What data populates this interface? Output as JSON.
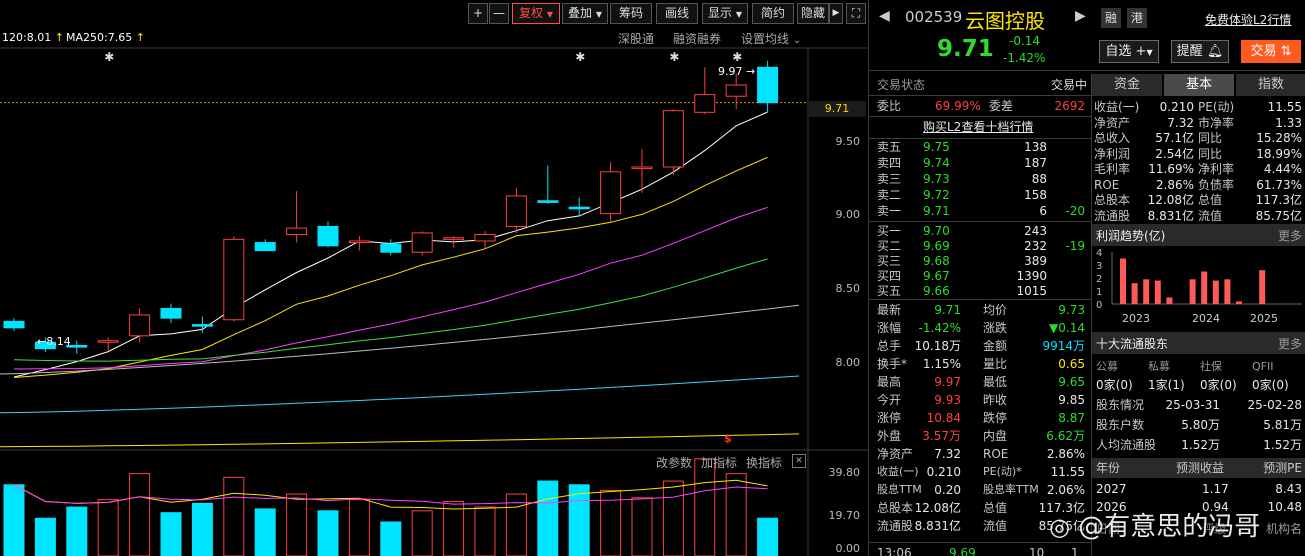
{
  "toolbar": {
    "plus": "+",
    "minus": "—",
    "fq": "复权",
    "overlay": "叠加",
    "chips": "筹码",
    "draw": "画线",
    "display": "显示",
    "simple": "简约",
    "hide": "隐藏",
    "arrow": "▶",
    "expand": "⛶"
  },
  "indicators": {
    "ma120": "120:8.01",
    "ma250": "MA250:7.65",
    "sgt": "深股通",
    "margin": "融资融券",
    "set_ma": "设置均线"
  },
  "chart_labels": {
    "high_mark": "9.97",
    "low_mark": "8.14",
    "last_price": "9.71",
    "s_mark": "$",
    "main_ticks": [
      "9.50",
      "9.00",
      "8.50",
      "8.00"
    ],
    "vol_ticks": [
      "39.80",
      "19.70",
      "0.00"
    ],
    "vol_tools": [
      "改参数",
      "加指标",
      "换指标"
    ],
    "close_glyph": "✕"
  },
  "chart_data": {
    "type": "candlestick",
    "ohlc": [
      [
        8.35,
        8.37,
        8.29,
        8.31
      ],
      [
        8.22,
        8.25,
        8.16,
        8.18
      ],
      [
        8.2,
        8.23,
        8.15,
        8.19
      ],
      [
        8.22,
        8.25,
        8.17,
        8.23
      ],
      [
        8.26,
        8.43,
        8.22,
        8.39
      ],
      [
        8.43,
        8.46,
        8.34,
        8.37
      ],
      [
        8.33,
        8.38,
        8.28,
        8.32
      ],
      [
        8.36,
        8.88,
        8.35,
        8.86
      ],
      [
        8.84,
        8.86,
        8.79,
        8.79
      ],
      [
        8.89,
        9.16,
        8.84,
        8.93
      ],
      [
        8.94,
        8.97,
        8.81,
        8.82
      ],
      [
        8.84,
        8.88,
        8.79,
        8.85
      ],
      [
        8.83,
        8.86,
        8.76,
        8.78
      ],
      [
        8.78,
        8.91,
        8.76,
        8.9
      ],
      [
        8.86,
        8.88,
        8.81,
        8.87
      ],
      [
        8.85,
        8.91,
        8.8,
        8.89
      ],
      [
        8.94,
        9.18,
        8.9,
        9.13
      ],
      [
        9.1,
        9.32,
        9.08,
        9.09
      ],
      [
        9.06,
        9.12,
        9.0,
        9.05
      ],
      [
        9.02,
        9.34,
        8.97,
        9.28
      ],
      [
        9.3,
        9.42,
        9.15,
        9.31
      ],
      [
        9.31,
        9.67,
        9.26,
        9.66
      ],
      [
        9.65,
        9.93,
        9.64,
        9.76
      ],
      [
        9.75,
        9.89,
        9.67,
        9.82
      ],
      [
        9.93,
        9.97,
        9.65,
        9.71
      ]
    ],
    "volume": [
      34,
      16,
      22,
      26,
      40,
      19,
      24,
      38,
      21,
      29,
      20,
      26,
      14,
      20,
      25,
      22,
      29,
      36,
      34,
      31,
      27,
      36,
      48,
      40,
      16
    ],
    "ma_values": {
      "ma120": 8.01,
      "ma250": 7.65
    },
    "ylim": [
      7.55,
      10.05
    ],
    "vol_ylim": [
      0,
      39.8
    ]
  },
  "stock": {
    "code": "002539",
    "name": "云图控股",
    "tag1": "融",
    "tag2": "港",
    "l2_link": "免费体验L2行情",
    "price": "9.71",
    "change": "-0.14",
    "change_pct": "-1.42%",
    "watch_btn": "自选",
    "alert_btn": "提醒",
    "trade_btn": "交易",
    "status_label": "交易状态",
    "status_value": "交易中",
    "ratio_label": "委比",
    "ratio_value": "69.99%",
    "diff_label": "委差",
    "diff_value": "2692",
    "buy_l2": "购买L2查看十档行情",
    "asks": [
      {
        "label": "卖五",
        "price": "9.75",
        "vol": "138",
        "chg": ""
      },
      {
        "label": "卖四",
        "price": "9.74",
        "vol": "187",
        "chg": ""
      },
      {
        "label": "卖三",
        "price": "9.73",
        "vol": "88",
        "chg": ""
      },
      {
        "label": "卖二",
        "price": "9.72",
        "vol": "158",
        "chg": ""
      },
      {
        "label": "卖一",
        "price": "9.71",
        "vol": "6",
        "chg": "-20"
      }
    ],
    "bids": [
      {
        "label": "买一",
        "price": "9.70",
        "vol": "243",
        "chg": ""
      },
      {
        "label": "买二",
        "price": "9.69",
        "vol": "232",
        "chg": "-19"
      },
      {
        "label": "买三",
        "price": "9.68",
        "vol": "389",
        "chg": ""
      },
      {
        "label": "买四",
        "price": "9.67",
        "vol": "1390",
        "chg": ""
      },
      {
        "label": "买五",
        "price": "9.66",
        "vol": "1015",
        "chg": ""
      }
    ],
    "quote": [
      [
        "最新",
        "9.71",
        "均价",
        "9.73"
      ],
      [
        "涨幅",
        "-1.42%",
        "涨跌",
        "▼0.14"
      ],
      [
        "总手",
        "10.18万",
        "金额",
        "9914万"
      ],
      [
        "换手*",
        "1.15%",
        "量比",
        "0.65"
      ],
      [
        "最高",
        "9.97",
        "最低",
        "9.65"
      ],
      [
        "今开",
        "9.93",
        "昨收",
        "9.85"
      ],
      [
        "涨停",
        "10.84",
        "跌停",
        "8.87"
      ],
      [
        "外盘",
        "3.57万",
        "内盘",
        "6.62万"
      ],
      [
        "净资产",
        "7.32",
        "ROE",
        "2.86%"
      ],
      [
        "收益(一)",
        "0.210",
        "PE(动)*",
        "11.55"
      ],
      [
        "股息TTM",
        "0.20",
        "股息率TTM",
        "2.06%"
      ],
      [
        "总股本",
        "12.08亿",
        "总值",
        "117.3亿"
      ],
      [
        "流通股",
        "8.831亿",
        "流值",
        "85.75亿"
      ]
    ],
    "trade_time": "13:06",
    "trade_price": "9.69",
    "trade_vol": "10",
    "trade_n": "1"
  },
  "tabs": [
    "资金",
    "基本",
    "指数"
  ],
  "fundamentals": [
    [
      "收益(一)",
      "0.210",
      "PE(动)",
      "11.55"
    ],
    [
      "净资产",
      "7.32",
      "市净率",
      "1.33"
    ],
    [
      "总收入",
      "57.1亿",
      "同比",
      "15.28%"
    ],
    [
      "净利润",
      "2.54亿",
      "同比",
      "18.99%"
    ],
    [
      "毛利率",
      "11.69%",
      "净利率",
      "4.44%"
    ],
    [
      "ROE",
      "2.86%",
      "负债率",
      "61.73%"
    ],
    [
      "总股本",
      "12.08亿",
      "总值",
      "117.3亿"
    ],
    [
      "流通股",
      "8.831亿",
      "流值",
      "85.75亿"
    ]
  ],
  "profit": {
    "title": "利润趋势(亿)",
    "more": "更多",
    "yticks": [
      "4",
      "3",
      "2",
      "1",
      "0"
    ],
    "years": [
      "2023",
      "2024",
      "2025"
    ],
    "bars": [
      3.5,
      1.6,
      1.9,
      1.8,
      0.5,
      1.9,
      2.5,
      1.8,
      1.9,
      0.2,
      2.6
    ]
  },
  "holders": {
    "title": "十大流通股东",
    "more": "更多",
    "types": [
      "公募",
      "私募",
      "社保",
      "QFII"
    ],
    "counts": [
      "0家(0)",
      "1家(1)",
      "0家(0)",
      "0家(0)"
    ],
    "rows": [
      [
        "股东情况",
        "25-03-31",
        "25-02-28"
      ],
      [
        "股东户数",
        "5.80万",
        "5.81万"
      ],
      [
        "人均流通股",
        "1.52万",
        "1.52万"
      ]
    ]
  },
  "forecast": {
    "headers": [
      "年份",
      "预测收益",
      "预测PE"
    ],
    "rows": [
      [
        "2027",
        "1.17",
        "8.43"
      ],
      [
        "2026",
        "0.94",
        "10.48"
      ]
    ],
    "footer": [
      "日期",
      "评级",
      "机构名"
    ]
  },
  "watermark": "@有意思的冯哥"
}
